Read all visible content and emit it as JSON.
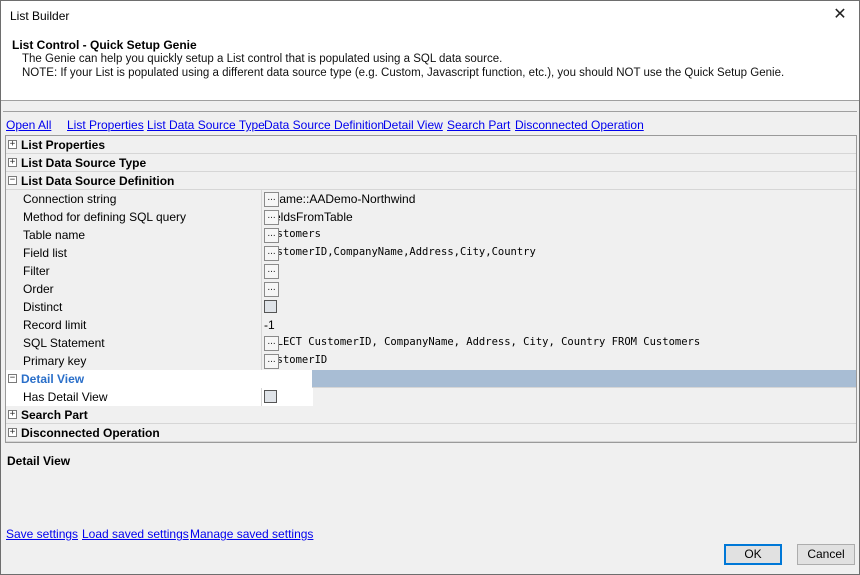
{
  "window": {
    "title": "List Builder",
    "close_glyph": "✕"
  },
  "header": {
    "title": "List Control - Quick Setup Genie",
    "line1": "The Genie can help you quickly setup a List control that is populated using a SQL data source.",
    "line2": "NOTE: If your List is populated using a different data source type (e.g. Custom, Javascript function, etc.), you should NOT use the Quick Setup Genie."
  },
  "nav_links": [
    "Open All",
    "List Properties",
    "List Data Source Type",
    "Data Source Definition",
    "Detail View",
    "Search Part",
    "Disconnected Operation"
  ],
  "grid": {
    "categories": {
      "list_properties": "List Properties",
      "list_data_source_type": "List Data Source Type",
      "list_data_source_definition": "List Data Source Definition",
      "detail_view": "Detail View",
      "search_part": "Search Part",
      "disconnected_operation": "Disconnected Operation"
    },
    "definition_props": [
      {
        "name": "Connection string",
        "value": "::Name::AADemo-Northwind"
      },
      {
        "name": "Method for defining SQL query",
        "value": "FieldsFromTable"
      },
      {
        "name": "Table name",
        "value": "Customers"
      },
      {
        "name": "Field list",
        "value": "CustomerID,CompanyName,Address,City,Country"
      },
      {
        "name": "Filter",
        "value": ""
      },
      {
        "name": "Order",
        "value": ""
      },
      {
        "name": "Distinct",
        "value": ""
      },
      {
        "name": "Record limit",
        "value": "-1"
      },
      {
        "name": "SQL Statement",
        "value": "SELECT CustomerID, CompanyName, Address, City, Country FROM Customers"
      },
      {
        "name": "Primary key",
        "value": "CustomerID"
      }
    ],
    "detail_props": [
      {
        "name": "Has Detail View",
        "value": ""
      }
    ],
    "ellipsis": "...",
    "expand_glyph": "+",
    "collapse_glyph": "−"
  },
  "description": {
    "title": "Detail View"
  },
  "bottom_links": [
    "Save settings",
    "Load saved settings",
    "Manage saved settings"
  ],
  "buttons": {
    "ok": "OK",
    "cancel": "Cancel"
  }
}
